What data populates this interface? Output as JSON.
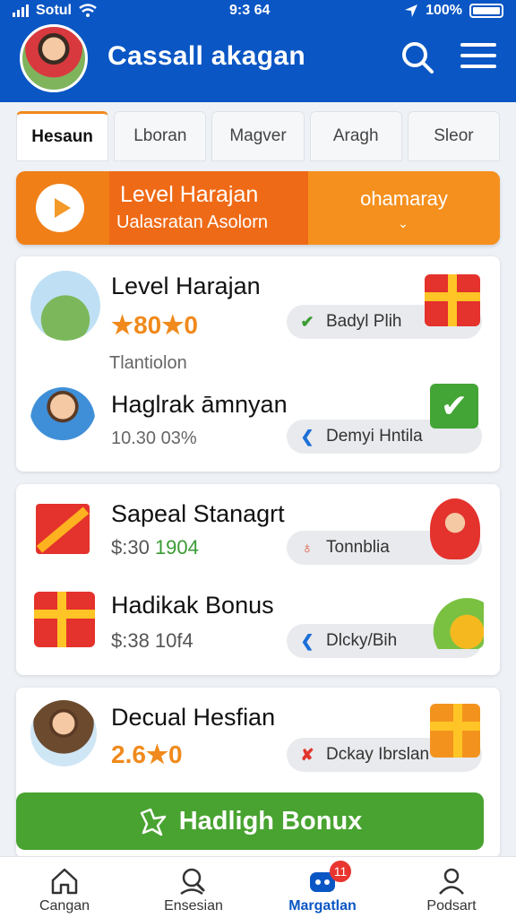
{
  "status_bar": {
    "carrier": "Sotul",
    "time": "9:3 64",
    "battery": "100%"
  },
  "header": {
    "title": "Cassall akagan"
  },
  "tabs": [
    {
      "label": "Hesaun",
      "active": true
    },
    {
      "label": "Lboran",
      "active": false
    },
    {
      "label": "Magver",
      "active": false
    },
    {
      "label": "Aragh",
      "active": false
    },
    {
      "label": "Sleor",
      "active": false
    }
  ],
  "banner": {
    "title": "Level Harajan",
    "subtitle": "Ualasratan Asolorn",
    "dropdown_label": "ohamaray"
  },
  "card1": {
    "row1": {
      "title": "Level Harajan",
      "rating": "★80★0",
      "caption": "Tlantiolon",
      "pill": "Badyl Plih"
    },
    "row2": {
      "title": "Haglrak āmnyan",
      "sub": "10.30 03%",
      "pill": "Demyi Hntila"
    }
  },
  "card2": {
    "row1": {
      "title": "Sapeal Stanagrt",
      "sub_prefix": "$:30 ",
      "sub_value": "1904",
      "pill": "Tonnblia"
    },
    "row2": {
      "title": "Hadikak Bonus",
      "sub": "$:38 10f4",
      "pill": "Dlcky/Bih"
    }
  },
  "card3": {
    "row1": {
      "title": "Decual Hesfian",
      "rating": "2.6★0",
      "pill": "Dckay Ibrslan"
    },
    "button": "Hadligh Bonux"
  },
  "bottom_nav": [
    {
      "label": "Cangan",
      "icon": "home-icon",
      "active": false
    },
    {
      "label": "Ensesian",
      "icon": "search-person-icon",
      "active": false
    },
    {
      "label": "Margatlan",
      "icon": "game-icon",
      "active": true,
      "badge": "11"
    },
    {
      "label": "Podsart",
      "icon": "profile-icon",
      "active": false
    }
  ],
  "colors": {
    "header": "#0a56c4",
    "accent": "#f08a1c",
    "button": "#48a330",
    "badge": "#e9352f"
  }
}
